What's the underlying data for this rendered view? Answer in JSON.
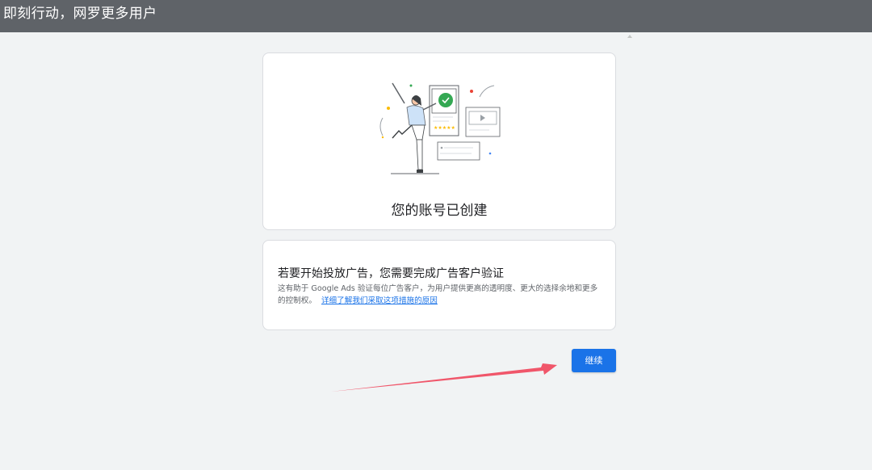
{
  "topbar": {
    "title": "即刻行动，网罗更多用户"
  },
  "account_card": {
    "title": "您的账号已创建",
    "illustration_rating": "★★★★★"
  },
  "verification_card": {
    "heading": "若要开始投放广告，您需要完成广告客户验证",
    "description": "这有助于 Google Ads 验证每位广告客户，为用户提供更高的透明度、更大的选择余地和更多的控制权。",
    "link_text": "详细了解我们采取这项措施的原因"
  },
  "actions": {
    "continue_label": "继续"
  },
  "colors": {
    "topbar_bg": "#5f6368",
    "page_bg": "#f1f3f4",
    "primary_blue": "#1a73e8",
    "arrow_red": "#f0566a",
    "check_green": "#34a853",
    "star_yellow": "#fbbc04"
  },
  "icons": {
    "check": "check-circle-icon",
    "play": "play-icon",
    "arrow": "pointer-arrow"
  }
}
